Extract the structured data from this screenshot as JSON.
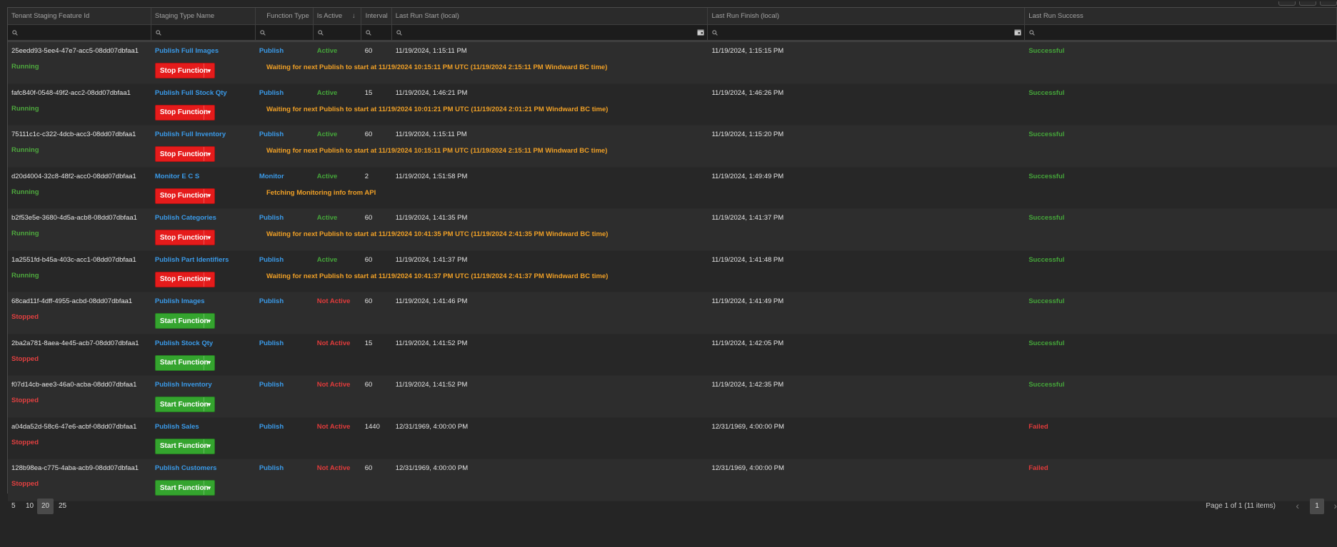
{
  "columns": [
    "Tenant Staging Feature Id",
    "Staging Type Name",
    "Function Type",
    "Is Active",
    "Interval",
    "Last Run Start (local)",
    "Last Run Finish (local)",
    "Last Run Success"
  ],
  "sort_indicator": "↓",
  "rows": [
    {
      "id": "25eedd93-5ee4-47e7-acc5-08dd07dbfaa1",
      "name": "Publish Full Images",
      "ftype": "Publish",
      "active": "Active",
      "interval": "60",
      "start": "11/19/2024, 1:15:11 PM",
      "finish": "11/19/2024, 1:15:15 PM",
      "success": "Successful",
      "status": "Running",
      "button": "Stop Function",
      "message": "Waiting for next Publish to start at 11/19/2024 10:15:11 PM UTC (11/19/2024 2:15:11 PM Windward BC time)"
    },
    {
      "id": "fafc840f-0548-49f2-acc2-08dd07dbfaa1",
      "name": "Publish Full Stock Qty",
      "ftype": "Publish",
      "active": "Active",
      "interval": "15",
      "start": "11/19/2024, 1:46:21 PM",
      "finish": "11/19/2024, 1:46:26 PM",
      "success": "Successful",
      "status": "Running",
      "button": "Stop Function",
      "message": "Waiting for next Publish to start at 11/19/2024 10:01:21 PM UTC (11/19/2024 2:01:21 PM Windward BC time)"
    },
    {
      "id": "75111c1c-c322-4dcb-acc3-08dd07dbfaa1",
      "name": "Publish Full Inventory",
      "ftype": "Publish",
      "active": "Active",
      "interval": "60",
      "start": "11/19/2024, 1:15:11 PM",
      "finish": "11/19/2024, 1:15:20 PM",
      "success": "Successful",
      "status": "Running",
      "button": "Stop Function",
      "message": "Waiting for next Publish to start at 11/19/2024 10:15:11 PM UTC (11/19/2024 2:15:11 PM Windward BC time)"
    },
    {
      "id": "d20d4004-32c8-48f2-acc0-08dd07dbfaa1",
      "name": "Monitor E C S",
      "ftype": "Monitor",
      "active": "Active",
      "interval": "2",
      "start": "11/19/2024, 1:51:58 PM",
      "finish": "11/19/2024, 1:49:49 PM",
      "success": "Successful",
      "status": "Running",
      "button": "Stop Function",
      "message": "Fetching Monitoring info from API"
    },
    {
      "id": "b2f53e5e-3680-4d5a-acb8-08dd07dbfaa1",
      "name": "Publish Categories",
      "ftype": "Publish",
      "active": "Active",
      "interval": "60",
      "start": "11/19/2024, 1:41:35 PM",
      "finish": "11/19/2024, 1:41:37 PM",
      "success": "Successful",
      "status": "Running",
      "button": "Stop Function",
      "message": "Waiting for next Publish to start at 11/19/2024 10:41:35 PM UTC (11/19/2024 2:41:35 PM Windward BC time)"
    },
    {
      "id": "1a2551fd-b45a-403c-acc1-08dd07dbfaa1",
      "name": "Publish Part Identifiers",
      "ftype": "Publish",
      "active": "Active",
      "interval": "60",
      "start": "11/19/2024, 1:41:37 PM",
      "finish": "11/19/2024, 1:41:48 PM",
      "success": "Successful",
      "status": "Running",
      "button": "Stop Function",
      "message": "Waiting for next Publish to start at 11/19/2024 10:41:37 PM UTC (11/19/2024 2:41:37 PM Windward BC time)"
    },
    {
      "id": "68cad11f-4dff-4955-acbd-08dd07dbfaa1",
      "name": "Publish Images",
      "ftype": "Publish",
      "active": "Not Active",
      "interval": "60",
      "start": "11/19/2024, 1:41:46 PM",
      "finish": "11/19/2024, 1:41:49 PM",
      "success": "Successful",
      "status": "Stopped",
      "button": "Start Function",
      "message": ""
    },
    {
      "id": "2ba2a781-8aea-4e45-acb7-08dd07dbfaa1",
      "name": "Publish Stock Qty",
      "ftype": "Publish",
      "active": "Not Active",
      "interval": "15",
      "start": "11/19/2024, 1:41:52 PM",
      "finish": "11/19/2024, 1:42:05 PM",
      "success": "Successful",
      "status": "Stopped",
      "button": "Start Function",
      "message": ""
    },
    {
      "id": "f07d14cb-aee3-46a0-acba-08dd07dbfaa1",
      "name": "Publish Inventory",
      "ftype": "Publish",
      "active": "Not Active",
      "interval": "60",
      "start": "11/19/2024, 1:41:52 PM",
      "finish": "11/19/2024, 1:42:35 PM",
      "success": "Successful",
      "status": "Stopped",
      "button": "Start Function",
      "message": ""
    },
    {
      "id": "a04da52d-58c6-47e6-acbf-08dd07dbfaa1",
      "name": "Publish Sales",
      "ftype": "Publish",
      "active": "Not Active",
      "interval": "1440",
      "start": "12/31/1969, 4:00:00 PM",
      "finish": "12/31/1969, 4:00:00 PM",
      "success": "Failed",
      "status": "Stopped",
      "button": "Start Function",
      "message": ""
    },
    {
      "id": "128b98ea-c775-4aba-acb9-08dd07dbfaa1",
      "name": "Publish Customers",
      "ftype": "Publish",
      "active": "Not Active",
      "interval": "60",
      "start": "12/31/1969, 4:00:00 PM",
      "finish": "12/31/1969, 4:00:00 PM",
      "success": "Failed",
      "status": "Stopped",
      "button": "Start Function",
      "message": ""
    }
  ],
  "pager": {
    "sizes": [
      "5",
      "10",
      "20",
      "25"
    ],
    "selected_size": "20",
    "info": "Page 1 of 1 (11 items)",
    "current_page": "1"
  },
  "colors": {
    "link_blue": "#3a9ae8",
    "active_green": "#45a53a",
    "inactive_red": "#e13b3b",
    "message_orange": "#f0a026",
    "stop_button": "#e51b1b",
    "start_button": "#34a42e"
  }
}
